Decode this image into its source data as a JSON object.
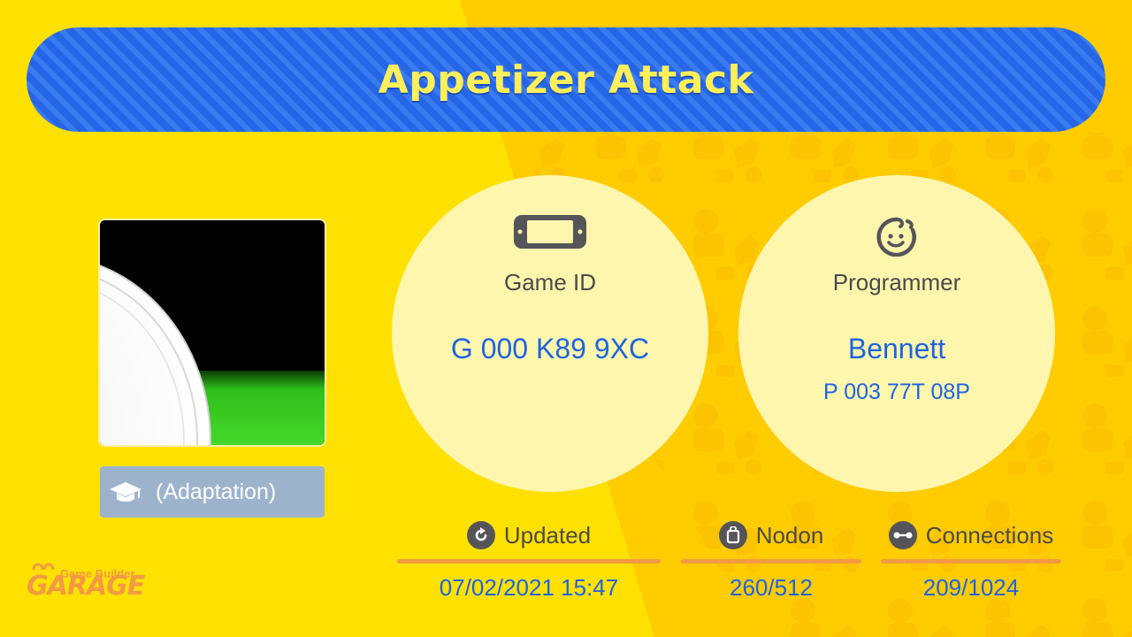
{
  "title": "Appetizer Attack",
  "adaptation": {
    "label": "(Adaptation)",
    "icon": "graduation-cap-icon"
  },
  "game_id": {
    "icon": "console-icon",
    "label": "Game ID",
    "value": "G 000 K89 9XC"
  },
  "programmer": {
    "icon": "child-face-icon",
    "label": "Programmer",
    "name": "Bennett",
    "id": "P 003 77T 08P"
  },
  "stats": {
    "updated": {
      "icon": "refresh-icon",
      "label": "Updated",
      "value": "07/02/2021 15:47"
    },
    "nodon": {
      "icon": "nodon-bag-icon",
      "label": "Nodon",
      "value": "260/512"
    },
    "connections": {
      "icon": "connection-icon",
      "label": "Connections",
      "value": "209/1024"
    }
  },
  "logo": {
    "small": "Game Builder",
    "big": "GARAGE"
  },
  "colors": {
    "background": "#FFE100",
    "background_right": "#FFCC00",
    "banner": "#2566E6",
    "title_text": "#FFEF5A",
    "circle": "#FFF6AE",
    "value_text": "#1F63E0",
    "accent_orange": "#F39A42",
    "badge": "#9DB3CC"
  }
}
